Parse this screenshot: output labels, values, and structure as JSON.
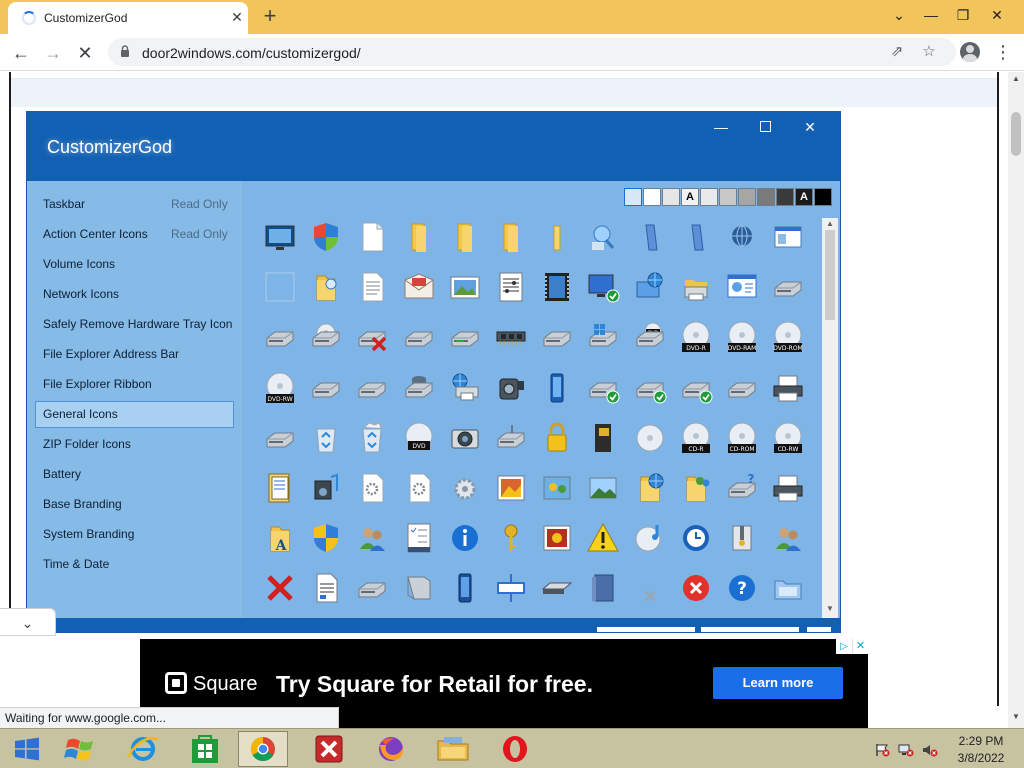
{
  "browser": {
    "tab_title": "CustomizerGod",
    "url": "door2windows.com/customizergod/",
    "status_text": "Waiting for www.google.com...",
    "icons": {
      "tab_close": "close-icon",
      "new_tab": "plus-icon",
      "minimize": "chevron-down-icon",
      "back": "arrow-left-icon",
      "forward": "arrow-right-icon",
      "stop": "close-icon",
      "lock": "lock-icon",
      "share": "share-icon",
      "bookmark": "star-icon",
      "profile": "avatar-icon",
      "menu": "kebab-menu-icon"
    },
    "glyphs": {
      "tab_close": "✕",
      "new_tab": "+",
      "tabs_menu": "⌄",
      "win_min": "—",
      "win_restore": "❐",
      "win_close": "✕",
      "back": "←",
      "forward": "→",
      "stop": "✕",
      "share": "⇗",
      "star": "☆",
      "kebab": "⋮",
      "chevron": "⌄",
      "up": "▲",
      "down": "▼"
    }
  },
  "app": {
    "title": "CustomizerGod",
    "window_glyphs": {
      "minimize": "—",
      "close": "✕"
    },
    "sidebar": [
      {
        "label": "Taskbar",
        "note": "Read Only"
      },
      {
        "label": "Action Center Icons",
        "note": "Read Only"
      },
      {
        "label": "Volume Icons",
        "note": ""
      },
      {
        "label": "Network Icons",
        "note": ""
      },
      {
        "label": "Safely Remove Hardware Tray Icon",
        "note": ""
      },
      {
        "label": "File Explorer Address Bar",
        "note": ""
      },
      {
        "label": "File Explorer Ribbon",
        "note": ""
      },
      {
        "label": "General Icons",
        "note": "",
        "active": true
      },
      {
        "label": "ZIP Folder Icons",
        "note": ""
      },
      {
        "label": "Battery",
        "note": ""
      },
      {
        "label": "Base Branding",
        "note": ""
      },
      {
        "label": "System Branding",
        "note": ""
      },
      {
        "label": "Time & Date",
        "note": ""
      }
    ],
    "swatches": [
      {
        "color": "#d7e8f8",
        "label": ""
      },
      {
        "color": "#ffffff",
        "label": ""
      },
      {
        "color": "#e6e6e6",
        "label": ""
      },
      {
        "color": "#f2f2f2",
        "label": "A"
      },
      {
        "color": "#e9e9e9",
        "label": ""
      },
      {
        "color": "#c8c8c8",
        "label": ""
      },
      {
        "color": "#a6a6a6",
        "label": ""
      },
      {
        "color": "#7a7a7a",
        "label": ""
      },
      {
        "color": "#3a3a3a",
        "label": ""
      },
      {
        "color": "#1a1a1a",
        "label": "A"
      },
      {
        "color": "#000000",
        "label": ""
      }
    ],
    "icon_labels": {
      "dvd_r": "DVD-R",
      "dvd_ram": "DVD-RAM",
      "dvd_rom": "DVD-ROM",
      "dvd_rw": "DVD-RW",
      "dvd": "DVD",
      "cd_r": "CD-R",
      "cd_rom": "CD-ROM",
      "cd_rw": "CD-RW"
    },
    "icons": [
      [
        "monitor-icon",
        "shield-icon",
        "document-icon",
        "folder-icon",
        "folder-icon",
        "folder-icon",
        "folder-open-icon",
        "search-folder-icon",
        "slim-folder-icon",
        "slim-folder-icon",
        "network-sphere-icon",
        "window-icon"
      ],
      [
        "blank-icon",
        "folder-search-icon",
        "document-lines-icon",
        "mail-icon",
        "picture-icon",
        "music-sheet-icon",
        "video-film-icon",
        "monitor-check-icon",
        "globe-monitor-icon",
        "printer-folder-icon",
        "control-panel-icon",
        "drive-icon"
      ],
      [
        "drive-icon",
        "drive-disc-icon",
        "drive-error-icon",
        "drive-icon",
        "drive-green-icon",
        "ram-chip-icon",
        "drive-icon",
        "drive-windows-icon",
        "drive-dvd-icon",
        "dvd-r-disc-icon",
        "dvd-ram-disc-icon",
        "dvd-rom-disc-icon"
      ],
      [
        "dvd-rw-disc-icon",
        "drive-icon",
        "drive-icon",
        "drive-server-icon",
        "network-printer-icon",
        "camcorder-icon",
        "phone-icon",
        "drive-check-icon",
        "drive-check-icon",
        "drive-check-icon",
        "drive-icon",
        "printer-icon"
      ],
      [
        "drive-icon",
        "recycle-bin-icon",
        "recycle-bin-full-icon",
        "dvd-disc-icon",
        "camera-icon",
        "drive-network-icon",
        "lock-icon",
        "sd-card-icon",
        "cd-disc-icon",
        "cd-r-disc-icon",
        "cd-rom-disc-icon",
        "cd-rw-disc-icon"
      ],
      [
        "book-icon",
        "media-player-icon",
        "settings-doc-icon",
        "settings-doc-icon",
        "gear-icon",
        "photo-frame-icon",
        "photo-people-icon",
        "landscape-icon",
        "folder-globe-icon",
        "folder-users-icon",
        "help-drive-icon",
        "printer-icon"
      ],
      [
        "font-folder-icon",
        "uac-shield-icon",
        "users-icon",
        "checklist-icon",
        "info-icon",
        "key-icon",
        "photo-flower-icon",
        "warning-icon",
        "cd-music-icon",
        "clock-sync-icon",
        "zip-icon",
        "users-icon"
      ],
      [
        "error-x-icon",
        "document-text-icon",
        "drive-icon",
        "scanner-icon",
        "smartphone-icon",
        "projector-icon",
        "scanner-flat-icon",
        "book-blue-icon",
        "mini-x-icon",
        "error-circle-icon",
        "help-circle-icon",
        "folder-blue-icon"
      ]
    ]
  },
  "ad": {
    "brand": "Square",
    "headline": "Try Square for Retail for free.",
    "cta": "Learn more",
    "adchoices": "▷",
    "close": "✕"
  },
  "taskbar": {
    "apps": [
      "start-button",
      "windows-flag-icon",
      "internet-explorer-icon",
      "store-icon",
      "chrome-icon",
      "close-app-icon",
      "firefox-icon",
      "file-explorer-icon",
      "opera-icon"
    ],
    "active_app": "chrome-icon",
    "time": "2:29 PM",
    "date": "3/8/2022"
  }
}
